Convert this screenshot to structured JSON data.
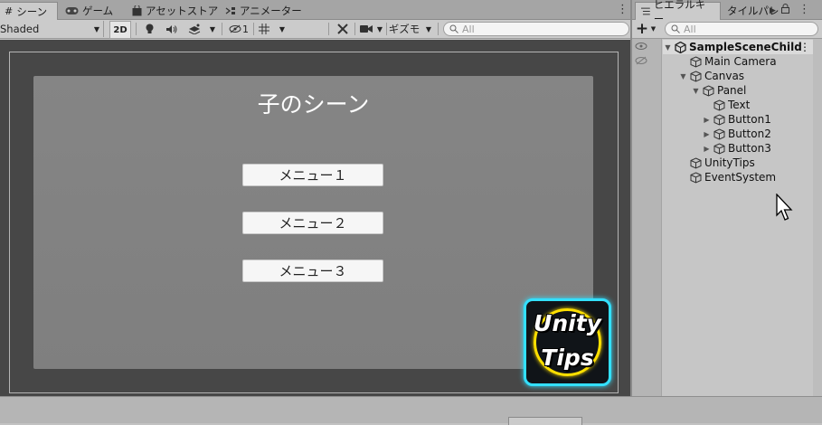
{
  "scene_panel": {
    "tabs": [
      {
        "label": "シーン",
        "icon": "grid-icon",
        "active": true
      },
      {
        "label": "ゲーム",
        "icon": "gamepad-icon",
        "active": false
      },
      {
        "label": "アセットストア",
        "icon": "shopping-bag-icon",
        "active": false
      },
      {
        "label": "アニメーター",
        "icon": "animator-icon",
        "active": false
      }
    ],
    "toolbar": {
      "shading_mode": "Shaded",
      "mode_2d": "2D",
      "hidden_count": "1",
      "gizmos": "ギズモ",
      "search_placeholder": "All"
    },
    "game_view": {
      "title": "子のシーン",
      "buttons": [
        "メニュー１",
        "メニュー２",
        "メニュー３"
      ],
      "logo": {
        "line1": "Unity",
        "line2": "Tips",
        "frame_color": "#33e0ff",
        "ring_color": "#ffe000"
      }
    }
  },
  "hierarchy_panel": {
    "tabs": [
      {
        "label": "ヒエラルキー",
        "icon": "list-icon",
        "active": true
      },
      {
        "label": "タイルパレ",
        "active": false
      }
    ],
    "search_placeholder": "All",
    "scene_name": "SampleSceneChild",
    "items": [
      {
        "label": "Main Camera",
        "depth": 1,
        "expanded": null
      },
      {
        "label": "Canvas",
        "depth": 1,
        "expanded": true
      },
      {
        "label": "Panel",
        "depth": 2,
        "expanded": true
      },
      {
        "label": "Text",
        "depth": 3,
        "expanded": null
      },
      {
        "label": "Button1",
        "depth": 3,
        "expanded": false
      },
      {
        "label": "Button2",
        "depth": 3,
        "expanded": false
      },
      {
        "label": "Button3",
        "depth": 3,
        "expanded": false
      },
      {
        "label": "UnityTips",
        "depth": 1,
        "expanded": null
      },
      {
        "label": "EventSystem",
        "depth": 1,
        "expanded": null
      }
    ]
  }
}
